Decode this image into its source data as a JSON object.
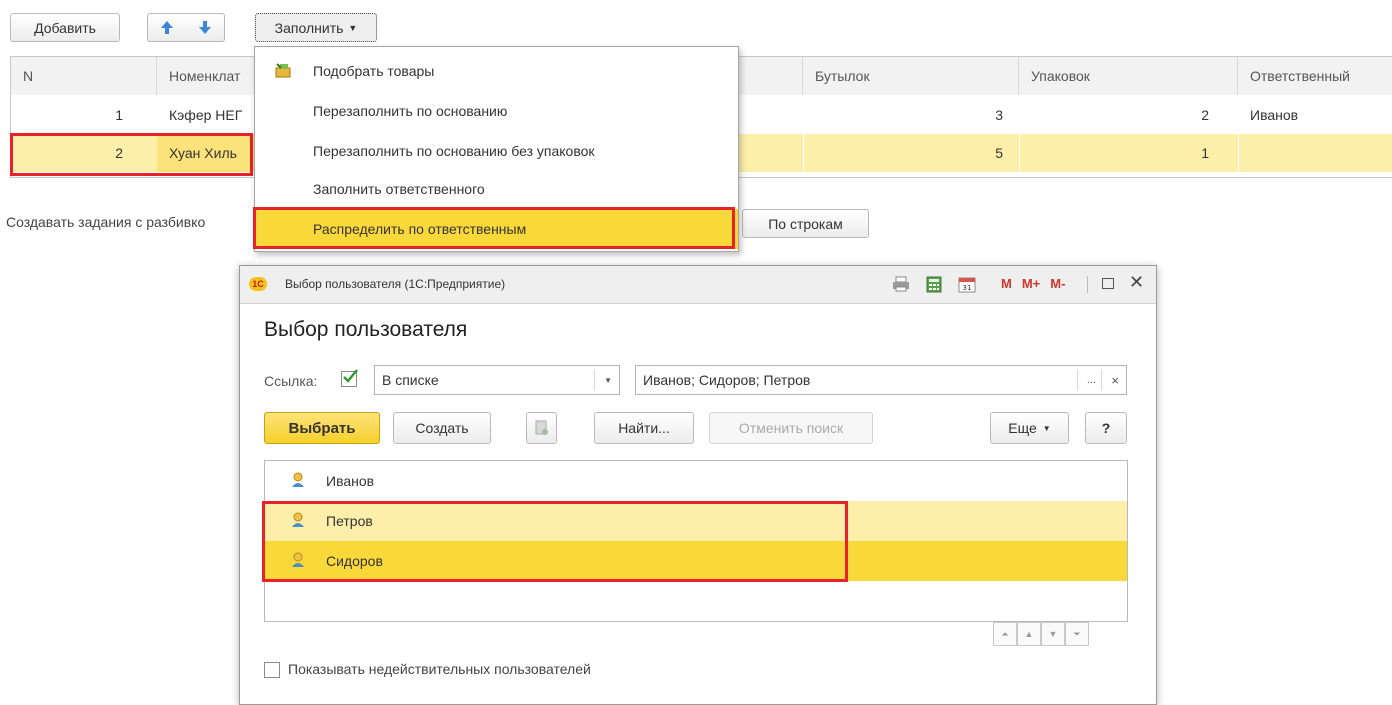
{
  "toolbar": {
    "add_label": "Добавить",
    "fill_label": "Заполнить",
    "by_rows_label": "По строкам"
  },
  "table": {
    "headers": [
      "N",
      "Номенклат",
      "Бутылок",
      "Упаковок",
      "Ответственный"
    ],
    "rows": [
      {
        "n": "1",
        "name": "Кэфер НЕГ",
        "bottles": "3",
        "packs": "2",
        "resp": "Иванов"
      },
      {
        "n": "2",
        "name": "Хуан Хиль",
        "bottles": "5",
        "packs": "1",
        "resp": ""
      }
    ]
  },
  "split_label": "Создавать задания с разбивко",
  "fill_menu": {
    "items": [
      "Подобрать товары",
      "Перезаполнить по основанию",
      "Перезаполнить по основанию без упаковок",
      "Заполнить ответственного",
      "Распределить по ответственным"
    ]
  },
  "dialog": {
    "window_title": "Выбор пользователя  (1С:Предприятие)",
    "logo_text": "1С",
    "heading": "Выбор пользователя",
    "memory_buttons": [
      "M",
      "M+",
      "M-"
    ],
    "filter": {
      "label": "Ссылка:",
      "mode": "В списке",
      "value": "Иванов; Сидоров; Петров",
      "more": "...",
      "clear": "×"
    },
    "buttons": {
      "select": "Выбрать",
      "create": "Создать",
      "find": "Найти...",
      "cancel_search": "Отменить поиск",
      "more": "Еще",
      "help": "?"
    },
    "users": [
      "Иванов",
      "Петров",
      "Сидоров"
    ],
    "show_invalid_label": "Показывать недействительных пользователей"
  },
  "colors": {
    "selected_row": "#fce27a",
    "highlight_row": "#fdefa9",
    "primary_button": "#f9d93a",
    "red_frame": "#e8212a"
  }
}
